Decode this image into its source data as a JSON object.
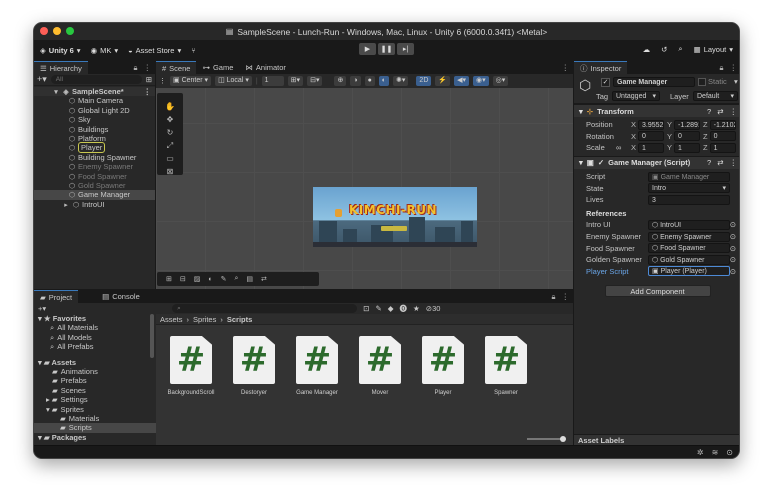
{
  "window": {
    "title": "SampleScene - Lunch-Run - Windows, Mac, Linux - Unity 6 (6000.0.34f1) <Metal>",
    "lights": [
      "#fe5f57",
      "#febc2e",
      "#28c840"
    ]
  },
  "toolbar": {
    "unity": "Unity 6",
    "account": "MK",
    "asset_store": "Asset Store",
    "layout": "Layout"
  },
  "hierarchy": {
    "tab": "Hierarchy",
    "search_placeholder": "All",
    "scene": "SampleScene*",
    "items": [
      {
        "label": "Main Camera",
        "dim": false
      },
      {
        "label": "Global Light 2D",
        "dim": false
      },
      {
        "label": "Sky",
        "dim": false
      },
      {
        "label": "Buildings",
        "dim": false
      },
      {
        "label": "Platform",
        "dim": false
      },
      {
        "label": "Player",
        "dim": false
      },
      {
        "label": "Building Spawner",
        "dim": false
      },
      {
        "label": "Enemy Spawner",
        "dim": true
      },
      {
        "label": "Food Spawner",
        "dim": true
      },
      {
        "label": "Gold Spawner",
        "dim": true
      },
      {
        "label": "Game Manager",
        "dim": false
      },
      {
        "label": "IntroUI",
        "dim": false
      }
    ]
  },
  "scene_tabs": {
    "scene": "Scene",
    "game": "Game",
    "animator": "Animator"
  },
  "scene_toolbar": {
    "pivot": "Center",
    "space": "Local",
    "snap": "1",
    "mode2d": "2D"
  },
  "game_view": {
    "title": "KIMCHI-RUN",
    "accent": "#f2c12e"
  },
  "inspector": {
    "tab": "Inspector",
    "object_name": "Game Manager",
    "static_label": "Static",
    "tag_label": "Tag",
    "tag_value": "Untagged",
    "layer_label": "Layer",
    "layer_value": "Default",
    "transform": {
      "title": "Transform",
      "position_label": "Position",
      "position": [
        "3.9552",
        "-1.2891",
        "-1.2102"
      ],
      "rotation_label": "Rotation",
      "rotation": [
        "0",
        "0",
        "0"
      ],
      "scale_label": "Scale",
      "scale": [
        "1",
        "1",
        "1"
      ]
    },
    "script_component": {
      "title": "Game Manager (Script)",
      "script_label": "Script",
      "script_value": "Game Manager",
      "state_label": "State",
      "state_value": "Intro",
      "lives_label": "Lives",
      "lives_value": "3",
      "references_label": "References",
      "refs": [
        {
          "label": "Intro UI",
          "value": "IntroUI"
        },
        {
          "label": "Enemy Spawner",
          "value": "Enemy Spawner"
        },
        {
          "label": "Food Spawner",
          "value": "Food Spawner"
        },
        {
          "label": "Golden Spawner",
          "value": "Gold Spawner"
        },
        {
          "label": "Player Script",
          "value": "Player (Player)"
        }
      ]
    },
    "add_component": "Add Component",
    "asset_labels": "Asset Labels"
  },
  "project": {
    "tab_project": "Project",
    "tab_console": "Console",
    "favorites": "Favorites",
    "fav_items": [
      "All Materials",
      "All Models",
      "All Prefabs"
    ],
    "assets": "Assets",
    "asset_folders": [
      "Animations",
      "Prefabs",
      "Scenes",
      "Settings",
      "Sprites"
    ],
    "sprite_children": [
      "Materials",
      "Scripts"
    ],
    "packages": "Packages",
    "breadcrumb": [
      "Assets",
      "Sprites",
      "Scripts"
    ],
    "hidden_count": "30",
    "files": [
      "BackgroundScroll",
      "Destoryer",
      "Game Manager",
      "Mover",
      "Player",
      "Spawner"
    ]
  }
}
